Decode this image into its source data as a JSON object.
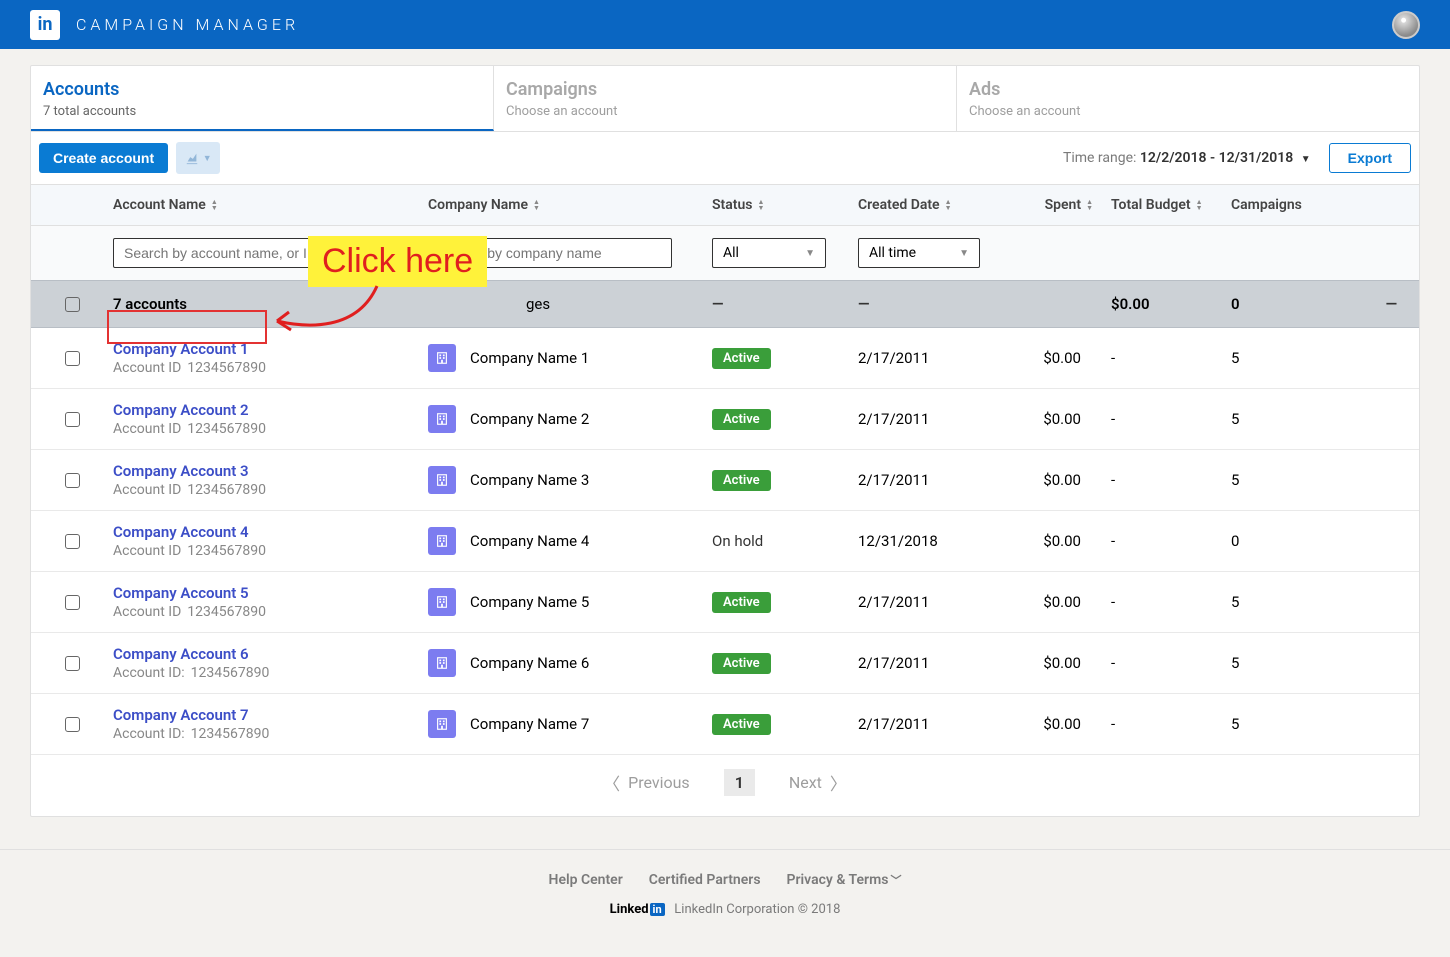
{
  "app": {
    "name": "CAMPAIGN MANAGER",
    "logo_glyph": "in"
  },
  "tabs": [
    {
      "title": "Accounts",
      "sub": "7 total accounts",
      "active": true
    },
    {
      "title": "Campaigns",
      "sub": "Choose an account",
      "active": false
    },
    {
      "title": "Ads",
      "sub": "Choose an account",
      "active": false
    }
  ],
  "toolbar": {
    "create": "Create account",
    "time_range_label": "Time range: ",
    "time_range_value": "12/2/2018 - 12/31/2018",
    "export": "Export"
  },
  "columns": {
    "account_name": "Account Name",
    "company_name": "Company Name",
    "status": "Status",
    "created_date": "Created Date",
    "spent": "Spent",
    "total_budget": "Total Budget",
    "campaigns": "Campaigns"
  },
  "filters": {
    "acct_placeholder": "Search by account name, or ID",
    "comp_placeholder": "Search by company name",
    "status_value": "All",
    "date_value": "All time"
  },
  "summary": {
    "count_text": "7 accounts",
    "pages_text": "ges",
    "budget": "$0.00",
    "campaigns": "0",
    "dash": "—"
  },
  "rows": [
    {
      "acct": "Company Account 1",
      "acct_id_label": "Account ID",
      "acct_id": "1234567890",
      "company": "Company Name 1",
      "status": "Active",
      "status_class": "green",
      "created": "2/17/2011",
      "spent": "$0.00",
      "budget": "-",
      "campaigns": "5"
    },
    {
      "acct": "Company Account 2",
      "acct_id_label": "Account ID",
      "acct_id": "1234567890",
      "company": "Company Name 2",
      "status": "Active",
      "status_class": "green",
      "created": "2/17/2011",
      "spent": "$0.00",
      "budget": "-",
      "campaigns": "5"
    },
    {
      "acct": "Company Account 3",
      "acct_id_label": "Account ID",
      "acct_id": "1234567890",
      "company": "Company Name 3",
      "status": "Active",
      "status_class": "green",
      "created": "2/17/2011",
      "spent": "$0.00",
      "budget": "-",
      "campaigns": "5"
    },
    {
      "acct": "Company Account 4",
      "acct_id_label": "Account ID",
      "acct_id": "1234567890",
      "company": "Company Name 4",
      "status": "On hold",
      "status_class": "plain",
      "created": "12/31/2018",
      "spent": "$0.00",
      "budget": "-",
      "campaigns": "0"
    },
    {
      "acct": "Company Account 5",
      "acct_id_label": "Account ID",
      "acct_id": "1234567890",
      "company": "Company Name 5",
      "status": "Active",
      "status_class": "green",
      "created": "2/17/2011",
      "spent": "$0.00",
      "budget": "-",
      "campaigns": "5"
    },
    {
      "acct": "Company Account 6",
      "acct_id_label": "Account ID:",
      "acct_id": "1234567890",
      "company": "Company Name 6",
      "status": "Active",
      "status_class": "green",
      "created": "2/17/2011",
      "spent": "$0.00",
      "budget": "-",
      "campaigns": "5"
    },
    {
      "acct": "Company Account 7",
      "acct_id_label": "Account ID:",
      "acct_id": "1234567890",
      "company": "Company Name 7",
      "status": "Active",
      "status_class": "green",
      "created": "2/17/2011",
      "spent": "$0.00",
      "budget": "-",
      "campaigns": "5"
    }
  ],
  "pager": {
    "prev": "Previous",
    "next": "Next",
    "current": "1"
  },
  "footer": {
    "links": {
      "help": "Help Center",
      "partners": "Certified Partners",
      "privacy": "Privacy & Terms"
    },
    "brand_text": "Linked",
    "brand_in": "in",
    "copyright": "LinkedIn Corporation © 2018"
  },
  "annotation": {
    "text": "Click here"
  }
}
